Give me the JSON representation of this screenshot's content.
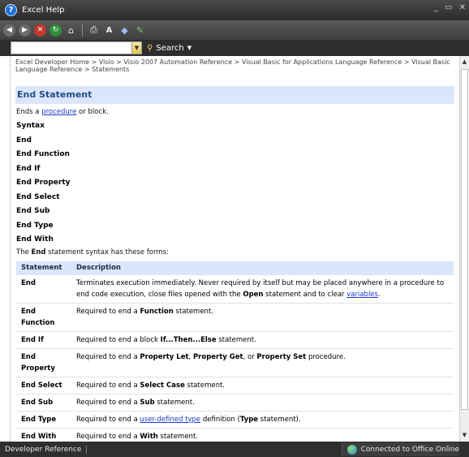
{
  "window": {
    "title": "Excel Help"
  },
  "search": {
    "value": "",
    "button_label": "Search"
  },
  "breadcrumb": "Excel Developer Home > Visio > Visio 2007 Automation Reference > Visual Basic for Applications Language Reference > Visual Basic Language Reference > Statements",
  "page": {
    "title": "End Statement",
    "intro_before": "Ends a ",
    "intro_link": "procedure",
    "intro_after": " or block.",
    "syntax_heading": "Syntax",
    "syntax_lines": [
      "End",
      "End Function",
      "End If",
      "End Property",
      "End Select",
      "End Sub",
      "End Type",
      "End With"
    ],
    "forms_before": "The ",
    "forms_bold": "End",
    "forms_after": " statement syntax has these forms:"
  },
  "table": {
    "headers": [
      "Statement",
      "Description"
    ],
    "rows": [
      {
        "statement": "End",
        "parts": [
          {
            "t": "Terminates execution immediately. Never required by itself but may be placed anywhere in a procedure to end code execution, close files opened with the "
          },
          {
            "t": "Open",
            "b": true
          },
          {
            "t": " statement and to clear "
          },
          {
            "t": "variables",
            "link": true
          },
          {
            "t": "."
          }
        ]
      },
      {
        "statement": "End Function",
        "parts": [
          {
            "t": "Required to end a "
          },
          {
            "t": "Function",
            "b": true
          },
          {
            "t": " statement."
          }
        ]
      },
      {
        "statement": "End If",
        "parts": [
          {
            "t": "Required to end a block "
          },
          {
            "t": "If...Then...Else",
            "b": true
          },
          {
            "t": " statement."
          }
        ]
      },
      {
        "statement": "End Property",
        "parts": [
          {
            "t": "Required to end a "
          },
          {
            "t": "Property Let",
            "b": true
          },
          {
            "t": ", "
          },
          {
            "t": "Property Get",
            "b": true
          },
          {
            "t": ", or "
          },
          {
            "t": "Property Set",
            "b": true
          },
          {
            "t": " procedure."
          }
        ]
      },
      {
        "statement": "End Select",
        "parts": [
          {
            "t": "Required to end a "
          },
          {
            "t": "Select Case",
            "b": true
          },
          {
            "t": " statement."
          }
        ]
      },
      {
        "statement": "End Sub",
        "parts": [
          {
            "t": "Required to end a "
          },
          {
            "t": "Sub",
            "b": true
          },
          {
            "t": " statement."
          }
        ]
      },
      {
        "statement": "End Type",
        "parts": [
          {
            "t": "Required to end a "
          },
          {
            "t": "user-defined type",
            "link": true
          },
          {
            "t": " definition ("
          },
          {
            "t": "Type",
            "b": true
          },
          {
            "t": " statement)."
          }
        ]
      },
      {
        "statement": "End With",
        "parts": [
          {
            "t": "Required to end a "
          },
          {
            "t": "With",
            "b": true
          },
          {
            "t": " statement."
          }
        ]
      }
    ]
  },
  "status": {
    "left": "Developer Reference",
    "right": "Connected to Office Online"
  },
  "icons": [
    "back-icon",
    "forward-icon",
    "stop-icon",
    "refresh-icon",
    "home-icon",
    "print-icon",
    "font-size-icon",
    "keep-on-top-icon",
    "toc-icon"
  ],
  "colors": {
    "header_band": "#dbe5fb",
    "title_text": "#1f4e8a",
    "link": "#1a39c8"
  }
}
